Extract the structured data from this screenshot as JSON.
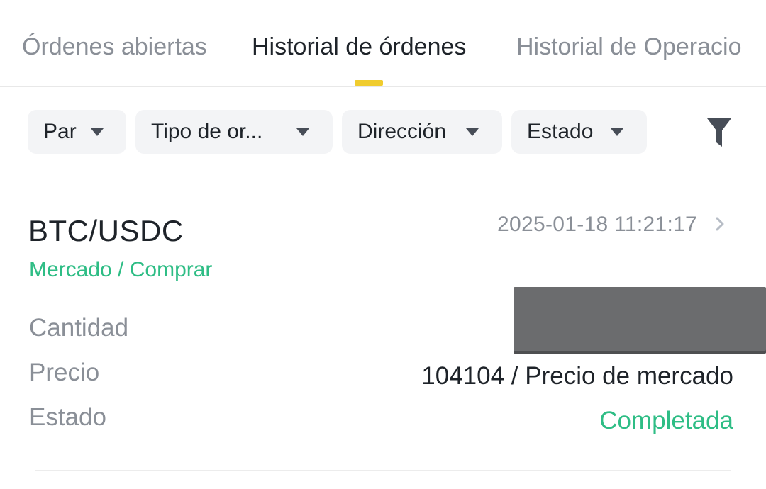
{
  "tabs": [
    {
      "label": "Órdenes abiertas",
      "active": false
    },
    {
      "label": "Historial de órdenes",
      "active": true
    },
    {
      "label": "Historial de Operacio",
      "active": false
    }
  ],
  "filters": {
    "par": "Par",
    "tipo": "Tipo de or...",
    "direccion": "Dirección",
    "estado": "Estado",
    "icon": "filter-icon"
  },
  "order": {
    "pair": "BTC/USDC",
    "type": "Mercado / Comprar",
    "timestamp": "2025-01-18 11:21:17",
    "labels": {
      "cantidad": "Cantidad",
      "precio": "Precio",
      "estado": "Estado"
    },
    "values": {
      "precio": "104104 / Precio de mercado",
      "estado": "Completada"
    }
  },
  "colors": {
    "accent": "#f0cc2e",
    "buy_green": "#2ebd85",
    "text_primary": "#1e2329",
    "text_secondary": "#8a8f97",
    "chip_bg": "#f3f4f6"
  }
}
